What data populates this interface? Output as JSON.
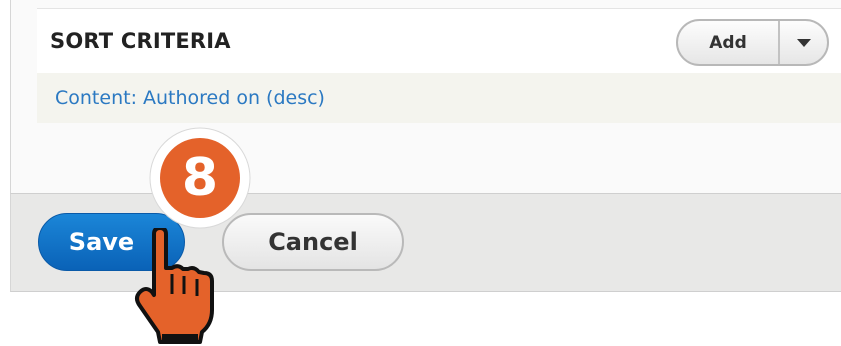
{
  "sort_criteria": {
    "title": "SORT CRITERIA",
    "add_label": "Add",
    "items": [
      "Content: Authored on (desc)"
    ]
  },
  "actions": {
    "save_label": "Save",
    "cancel_label": "Cancel"
  },
  "annotation": {
    "step_number": "8",
    "badge_color": "#e4622a"
  },
  "icons": {
    "toggle": "caret-down-icon",
    "pointer": "hand-pointer-icon"
  },
  "colors": {
    "primary": "#0a62b7",
    "link": "#2b79c2",
    "accent": "#e4622a"
  }
}
